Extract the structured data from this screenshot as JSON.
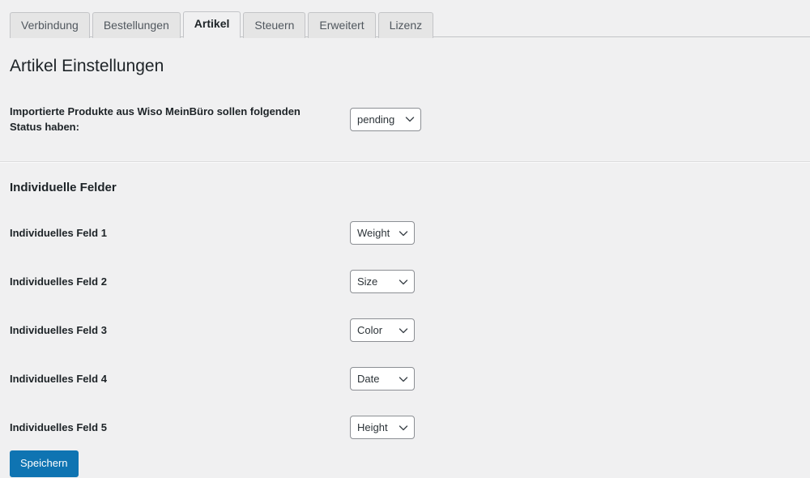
{
  "tabs": [
    {
      "label": "Verbindung",
      "active": false
    },
    {
      "label": "Bestellungen",
      "active": false
    },
    {
      "label": "Artikel",
      "active": true
    },
    {
      "label": "Steuern",
      "active": false
    },
    {
      "label": "Erweitert",
      "active": false
    },
    {
      "label": "Lizenz",
      "active": false
    }
  ],
  "page": {
    "title": "Artikel Einstellungen"
  },
  "status_setting": {
    "label": "Importierte Produkte aus Wiso MeinBüro sollen folgenden Status haben:",
    "select": {
      "value": "pending",
      "icon": "chevron-down-icon"
    }
  },
  "custom_fields": {
    "section_title": "Individuelle Felder",
    "rows": [
      {
        "label": "Individuelles Feld 1",
        "value": "Weight"
      },
      {
        "label": "Individuelles Feld 2",
        "value": "Size"
      },
      {
        "label": "Individuelles Feld 3",
        "value": "Color"
      },
      {
        "label": "Individuelles Feld 4",
        "value": "Date"
      },
      {
        "label": "Individuelles Feld 5",
        "value": "Height"
      }
    ]
  },
  "actions": {
    "save_label": "Speichern"
  },
  "colors": {
    "page_background": "#f0f0f1",
    "text": "#1d2327",
    "tab_inactive_background": "#e5e5e5",
    "border": "#c3c4c7",
    "primary_button": "#0f74b2"
  }
}
